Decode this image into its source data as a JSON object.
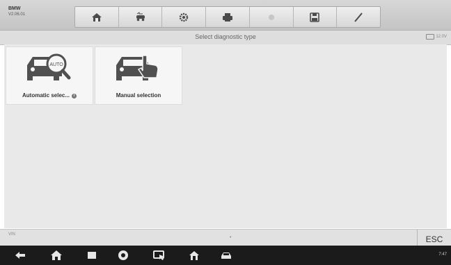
{
  "header": {
    "vehicle": "BMW",
    "version": "V2.06.01"
  },
  "toolbar": {
    "icons": [
      "home-icon",
      "vehicle-swap-icon",
      "settings-icon",
      "print-icon",
      "help-icon",
      "save-icon",
      "datalogging-icon"
    ]
  },
  "title": "Select diagnostic type",
  "battery": "12.0V",
  "options": [
    {
      "label": "Automatic selec...",
      "icon": "auto-vin-car-icon"
    },
    {
      "label": "Manual selection",
      "icon": "manual-car-icon"
    }
  ],
  "status": {
    "vin": "VIN",
    "esc": "ESC"
  },
  "navbar": {
    "time": "7:47"
  }
}
